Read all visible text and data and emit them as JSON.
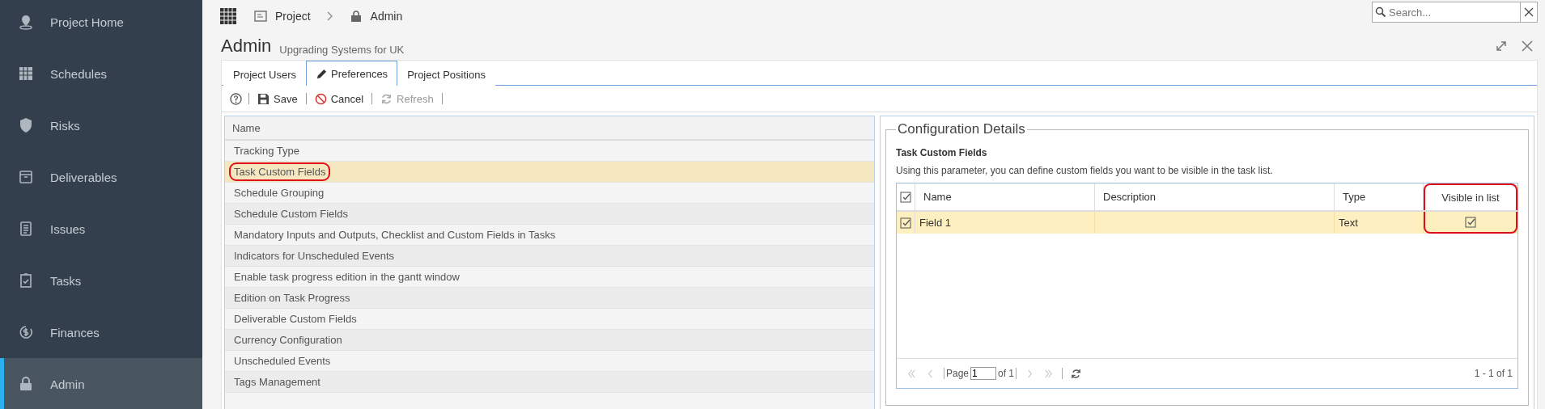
{
  "sidebar": {
    "items": [
      {
        "label": "Project Home",
        "selected": false
      },
      {
        "label": "Schedules",
        "selected": false
      },
      {
        "label": "Risks",
        "selected": false
      },
      {
        "label": "Deliverables",
        "selected": false
      },
      {
        "label": "Issues",
        "selected": false
      },
      {
        "label": "Tasks",
        "selected": false
      },
      {
        "label": "Finances",
        "selected": false
      },
      {
        "label": "Admin",
        "selected": true
      }
    ]
  },
  "topbar": {
    "breadcrumb": [
      "Project",
      "Admin"
    ],
    "search": {
      "placeholder": "Search..."
    }
  },
  "page": {
    "title": "Admin",
    "subtitle": "Upgrading Systems for UK"
  },
  "tabs": [
    {
      "label": "Project Users",
      "selected": false
    },
    {
      "label": "Preferences",
      "selected": true
    },
    {
      "label": "Project Positions",
      "selected": false
    }
  ],
  "toolbar": [
    {
      "label": "Save",
      "disabled": false
    },
    {
      "label": "Cancel",
      "disabled": false
    },
    {
      "label": "Refresh",
      "disabled": true
    }
  ],
  "settings_list": {
    "column": "Name",
    "rows": [
      {
        "label": "Tracking Type",
        "selected": false,
        "circled": false
      },
      {
        "label": "Task Custom Fields",
        "selected": true,
        "circled": true
      },
      {
        "label": "Schedule Grouping",
        "selected": false,
        "circled": false
      },
      {
        "label": "Schedule Custom Fields",
        "selected": false,
        "circled": false
      },
      {
        "label": "Mandatory Inputs and Outputs, Checklist and Custom Fields in Tasks",
        "selected": false,
        "circled": false
      },
      {
        "label": "Indicators for Unscheduled Events",
        "selected": false,
        "circled": false
      },
      {
        "label": "Enable task progress edition in the gantt window",
        "selected": false,
        "circled": false
      },
      {
        "label": "Edition on Task Progress",
        "selected": false,
        "circled": false
      },
      {
        "label": "Deliverable Custom Fields",
        "selected": false,
        "circled": false
      },
      {
        "label": "Currency Configuration",
        "selected": false,
        "circled": false
      },
      {
        "label": "Unscheduled Events",
        "selected": false,
        "circled": false
      },
      {
        "label": "Tags Management",
        "selected": false,
        "circled": false
      }
    ]
  },
  "details": {
    "legend": "Configuration Details",
    "heading": "Task Custom Fields",
    "description": "Using this parameter, you can define custom fields you want to be visible in the task list.",
    "columns": [
      {
        "label": "Name",
        "circled": false
      },
      {
        "label": "Description",
        "circled": false
      },
      {
        "label": "Type",
        "circled": false
      },
      {
        "label": "Visible in list",
        "circled": true
      }
    ],
    "rows": [
      {
        "checked": true,
        "name": "Field 1",
        "type": "Text",
        "visible_in_list": true,
        "selected": true
      }
    ],
    "pager": {
      "page_label": "Page",
      "page": "1",
      "of": "of 1",
      "summary": "1 - 1 of 1"
    }
  }
}
